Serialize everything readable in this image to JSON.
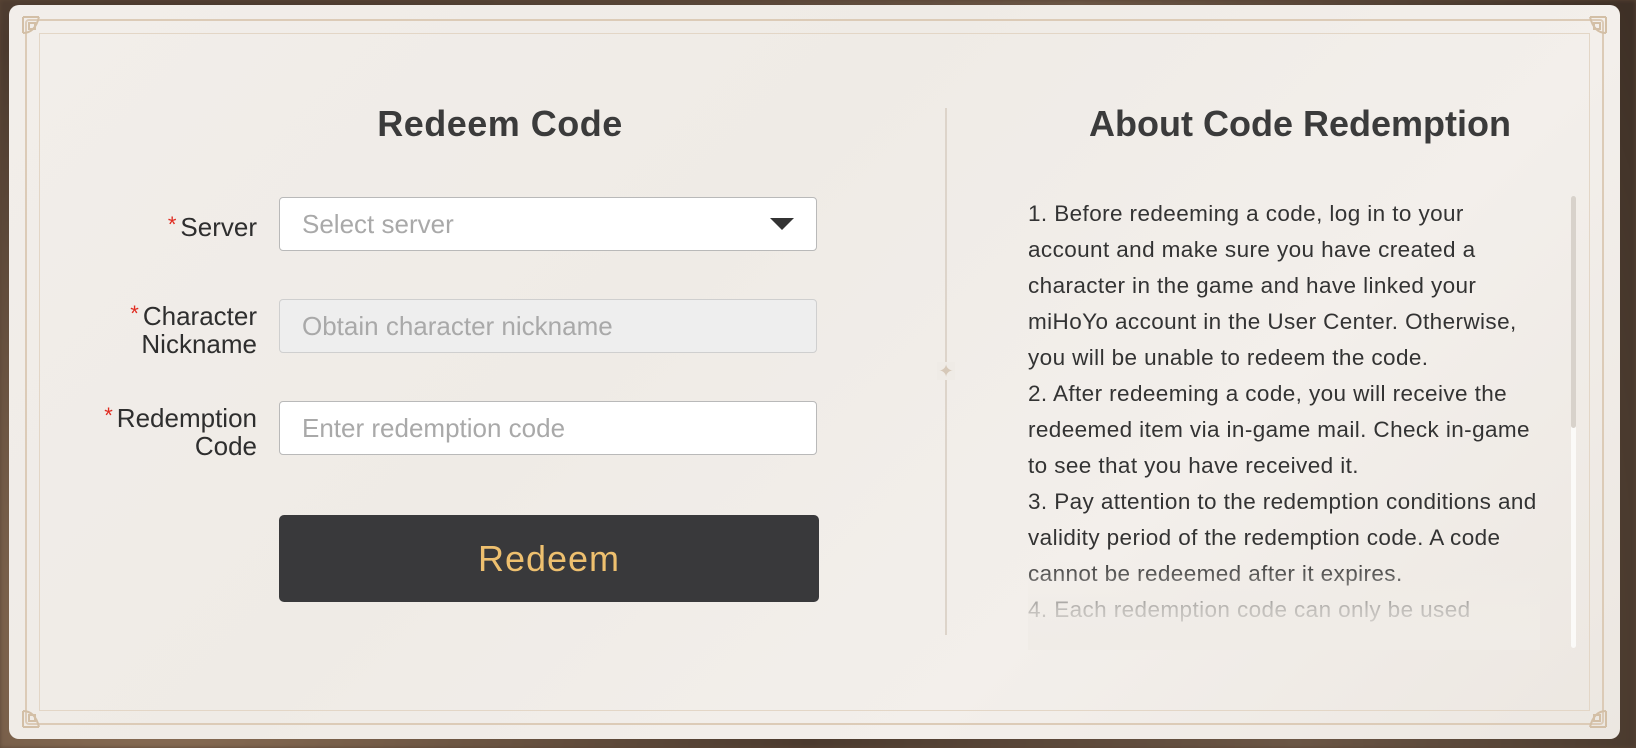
{
  "form": {
    "title": "Redeem Code",
    "required_mark": "*",
    "server": {
      "label": "Server",
      "placeholder": "Select server"
    },
    "nickname": {
      "label_line1": "Character",
      "label_line2": "Nickname",
      "placeholder": "Obtain character nickname"
    },
    "code": {
      "label_line1": "Redemption",
      "label_line2": "Code",
      "placeholder": "Enter redemption code"
    },
    "submit_label": "Redeem"
  },
  "about": {
    "title": "About Code Redemption",
    "items": [
      "1. Before redeeming a code, log in to your account and make sure you have created a character in the game and have linked your miHoYo account in the User Center. Otherwise, you will be unable to redeem the code.",
      "2. After redeeming a code, you will receive the redeemed item via in-game mail. Check in-game to see that you have received it.",
      "3. Pay attention to the redemption conditions and validity period of the redemption code. A code cannot be redeemed after it expires.",
      "4. Each redemption code can only be used"
    ]
  },
  "colors": {
    "button_bg": "#39393b",
    "button_text": "#eec06f",
    "required": "#e02b20",
    "frame": "#dccbb7"
  }
}
